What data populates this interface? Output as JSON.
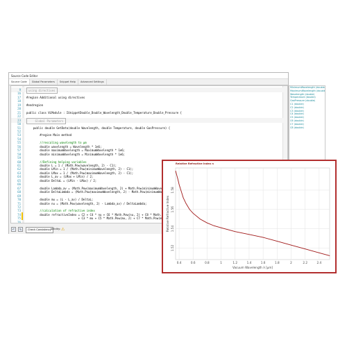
{
  "editor": {
    "title": "Source Code Editor",
    "tabs": [
      "Source Code",
      "Global Parameters",
      "Snippet Help",
      "Advanced Settings"
    ],
    "code_lines": [
      {
        "num": "9",
        "text": "using directives",
        "kind": "collapsed"
      },
      {
        "num": "16",
        "text": "",
        "kind": "plain"
      },
      {
        "num": "17",
        "text": "#region Additional using directives",
        "kind": "plain"
      },
      {
        "num": "18",
        "text": "",
        "kind": "plain"
      },
      {
        "num": "19",
        "text": "#endregion",
        "kind": "plain"
      },
      {
        "num": "20",
        "text": "",
        "kind": "plain"
      },
      {
        "num": "21",
        "text": "public class VLModule : IUnippetDouble_Double_Wavelength_Double_Temperature_Double_Pressure {",
        "kind": "plain"
      },
      {
        "num": "22",
        "text": "",
        "kind": "plain"
      },
      {
        "num": "23",
        "text": "    Global Parameters",
        "kind": "collapsed"
      },
      {
        "num": "50",
        "text": "",
        "kind": "plain"
      },
      {
        "num": "51",
        "text": "    public double GetData(double Wavelength, double Temperature, double GasPressure) {",
        "kind": "plain"
      },
      {
        "num": "52",
        "text": "",
        "kind": "plain"
      },
      {
        "num": "53",
        "text": "        #region Main method",
        "kind": "plain"
      },
      {
        "num": "54",
        "text": "",
        "kind": "plain"
      },
      {
        "num": "55",
        "text": "        //rescaling wavelength to μm",
        "kind": "comment"
      },
      {
        "num": "56",
        "text": "        double wavelength = Wavelength * 1e6;",
        "kind": "plain"
      },
      {
        "num": "57",
        "text": "        double maximumWavelength = MaximumWavelength * 1e6;",
        "kind": "plain"
      },
      {
        "num": "58",
        "text": "        double minimumWavelength = MinimumWavelength * 1e6;",
        "kind": "plain"
      },
      {
        "num": "59",
        "text": "",
        "kind": "plain"
      },
      {
        "num": "60",
        "text": "        //Defining helping variables",
        "kind": "comment"
      },
      {
        "num": "61",
        "text": "        double L = 1 / (Math.Pow(wavelength, 2) - C1);",
        "kind": "plain"
      },
      {
        "num": "62",
        "text": "        double LMin = 1 / (Math.Pow(minimumWavelength, 2) - C1);",
        "kind": "plain"
      },
      {
        "num": "63",
        "text": "        double LMax = 1 / (Math.Pow(maximumWavelength, 2) - C1);",
        "kind": "plain"
      },
      {
        "num": "64",
        "text": "        double L_av = (LMax + LMin) / 2;",
        "kind": "plain"
      },
      {
        "num": "65",
        "text": "        double DeltaL = (LMin - LMax) / 2;",
        "kind": "plain"
      },
      {
        "num": "66",
        "text": "",
        "kind": "plain"
      },
      {
        "num": "67",
        "text": "        double Lambda_av = (Math.Pow(maximumWavelength, 2) + Math.Pow(minimumWavelength, 2)) / 2;",
        "kind": "plain"
      },
      {
        "num": "68",
        "text": "        double DeltaLambda = (Math.Pow(maximumWavelength, 2) - Math.Pow(minimumWavelength, 2)) / 2;",
        "kind": "plain"
      },
      {
        "num": "69",
        "text": "",
        "kind": "plain"
      },
      {
        "num": "70",
        "text": "        double mu = (L - L_av) / DeltaL;",
        "kind": "plain"
      },
      {
        "num": "71",
        "text": "        double nu = (Math.Pow(wavelength, 2) - Lambda_av) / DeltaLambda;",
        "kind": "plain"
      },
      {
        "num": "72",
        "text": "",
        "kind": "plain"
      },
      {
        "num": "73",
        "text": "        //calculation of refractive index",
        "kind": "comment"
      },
      {
        "num": "74",
        "text": "        double refractiveIndex = C2 + C4 * nu + C6 * Math.Pow(nu, 2) + C8 * Math.Pow(nu, 3)",
        "kind": "plain"
      },
      {
        "num": "75",
        "text": "                               + C3 * mu + C5 * Math.Pow(mu, 2) + C7 * Math.Pow(mu, 3);",
        "kind": "plain"
      },
      {
        "num": "76",
        "text": "",
        "kind": "plain"
      }
    ],
    "params": [
      "MinimumWavelength (double)",
      "MaximumWavelength (double)",
      "Wavelength (double)",
      "Temperature (double)",
      "GasPressure (double)",
      "C1 (double)",
      "C2 (double)",
      "C3 (double)",
      "C4 (double)",
      "C5 (double)",
      "C6 (double)",
      "C7 (double)",
      "C8 (double)"
    ],
    "check_button": "Check Consistency",
    "validity_label": "Validity:"
  },
  "chart_data": {
    "type": "line",
    "title": "Relative Refractive Index n",
    "xlabel": "Vacuum Wavelength λ [μm]",
    "ylabel": "Relative Refractive Index",
    "xlim": [
      0.35,
      2.55
    ],
    "ylim": [
      1.508,
      1.603
    ],
    "x_ticks": [
      "0.4",
      "0.6",
      "0.8",
      "1",
      "1.2",
      "1.4",
      "1.6",
      "1.8",
      "2",
      "2.2",
      "2.4"
    ],
    "y_ticks": [
      "1.52",
      "1.54",
      "1.56",
      "1.58"
    ],
    "grid": true,
    "color": "#a01818",
    "series": [
      {
        "x": [
          0.35,
          0.38,
          0.4,
          0.43,
          0.46,
          0.5,
          0.55,
          0.6,
          0.7,
          0.8,
          0.9,
          1.0,
          1.2,
          1.4,
          1.6,
          1.8,
          2.0,
          2.2,
          2.4,
          2.55
        ],
        "y": [
          1.6,
          1.592,
          1.586,
          1.579,
          1.572,
          1.566,
          1.56,
          1.556,
          1.55,
          1.546,
          1.543,
          1.541,
          1.537,
          1.534,
          1.531,
          1.527,
          1.523,
          1.519,
          1.515,
          1.512
        ]
      }
    ]
  }
}
